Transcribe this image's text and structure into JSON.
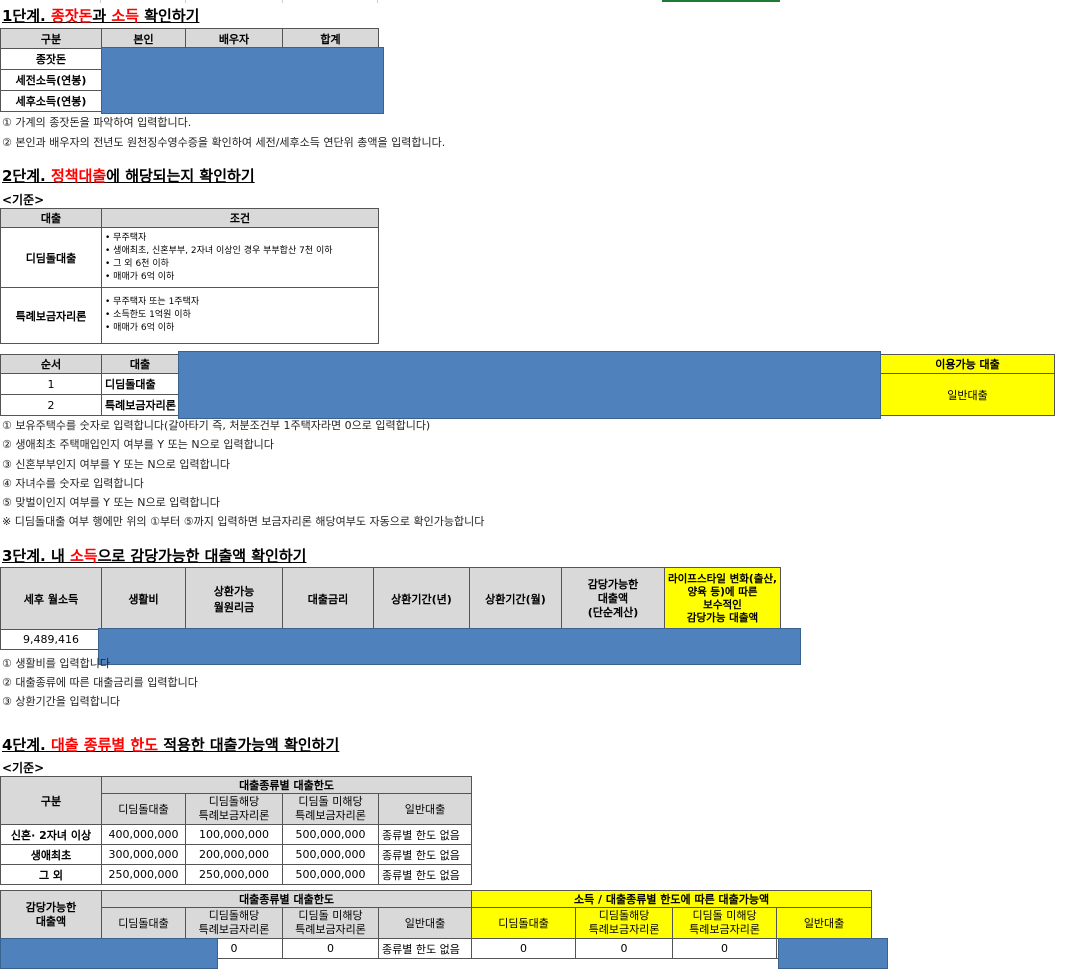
{
  "step1": {
    "title_prefix": "1단계. ",
    "title_red1": "종잣돈",
    "title_mid": "과 ",
    "title_red2": "소득",
    "title_suffix": " 확인하기",
    "headers": [
      "구분",
      "본인",
      "배우자",
      "합계"
    ],
    "rows": [
      "종잣돈",
      "세전소득(연봉)",
      "세후소득(연봉)"
    ],
    "notes": [
      "① 가계의 종잣돈을 파악하여 입력합니다.",
      "② 본인과 배우자의 전년도 원천징수영수증을 확인하여 세전/세후소득 연단위 총액을 입력합니다."
    ]
  },
  "step2": {
    "title_prefix": "2단계. ",
    "title_red": "정책대출",
    "title_suffix": "에 해당되는지 확인하기",
    "criteria_label": "<기준>",
    "criteria_headers": [
      "대출",
      "조건"
    ],
    "criteria": [
      {
        "loan": "디딤돌대출",
        "conditions": [
          "• 무주택자",
          "• 생애최초, 신혼부부, 2자녀 이상인 경우 부부합산 7천 이하",
          "• 그 외 6천 이하",
          "• 매매가 6억 이하"
        ]
      },
      {
        "loan": "특례보금자리론",
        "conditions": [
          "• 무주택자 또는 1주택자",
          "• 소득한도 1억원 이하",
          "• 매매가 6억 이하"
        ]
      }
    ],
    "eval_headers": {
      "order": "순서",
      "loan": "대출",
      "available": "이용가능 대출"
    },
    "eval_rows": [
      {
        "order": "1",
        "loan": "디딤돌대출"
      },
      {
        "order": "2",
        "loan": "특례보금자리론"
      }
    ],
    "available_value": "일반대출",
    "notes": [
      "① 보유주택수를 숫자로 입력합니다(갈아타기 즉, 처분조건부 1주택자라면 0으로 입력합니다)",
      "② 생애최초 주택매입인지 여부를 Y 또는 N으로 입력합니다",
      "③ 신혼부부인지 여부를 Y 또는 N으로 입력합니다",
      "④ 자녀수를 숫자로 입력합니다",
      "⑤ 맞벌이인지 여부를 Y 또는 N으로 입력합니다",
      "※ 디딤돌대출 여부 행에만 위의 ①부터 ⑤까지 입력하면 보금자리론 해당여부도 자동으로 확인가능합니다"
    ]
  },
  "step3": {
    "title_prefix": "3단계. 내 ",
    "title_red": "소득",
    "title_suffix": "으로 감당가능한 대출액 확인하기",
    "headers": [
      "세후 월소득",
      "생활비",
      "상환가능\n월원리금",
      "대출금리",
      "상환기간(년)",
      "상환기간(월)",
      "감당가능한\n대출액\n(단순계산)",
      "라이프스타일 변화(출산, 양육 등)에 따른\n보수적인\n감당가능 대출액"
    ],
    "monthly_income": "9,489,416",
    "notes": [
      "① 생활비를 입력합니다",
      "② 대출종류에 따른 대출금리를 입력합니다",
      "③ 상환기간을 입력합니다"
    ]
  },
  "step4": {
    "title_prefix": "4단계. ",
    "title_red": "대출 종류별 한도",
    "title_suffix": " 적용한 대출가능액 확인하기",
    "criteria_label": "<기준>",
    "limit_group_header": "대출종류별 대출한도",
    "row_header": "구분",
    "loan_types": [
      "디딤돌대출",
      "디딤돌해당\n특례보금자리론",
      "디딤돌 미해당\n특례보금자리론",
      "일반대출"
    ],
    "limit_rows": [
      {
        "label": "신혼· 2자녀 이상",
        "values": [
          "400,000,000",
          "100,000,000",
          "500,000,000",
          "종류별 한도 없음"
        ]
      },
      {
        "label": "생애최초",
        "values": [
          "300,000,000",
          "200,000,000",
          "500,000,000",
          "종류별 한도 없음"
        ]
      },
      {
        "label": "그 외",
        "values": [
          "250,000,000",
          "250,000,000",
          "500,000,000",
          "종류별 한도 없음"
        ]
      }
    ],
    "result_label": "감당가능한\n대출액",
    "result_group_limit": "대출종류별 대출한도",
    "result_group_available": "소득 / 대출종류별 한도에 따른 대출가능액",
    "result_values_limit": [
      "0",
      "0",
      "종류별 한도 없음"
    ],
    "result_values_available": [
      "0",
      "0",
      "0"
    ]
  }
}
